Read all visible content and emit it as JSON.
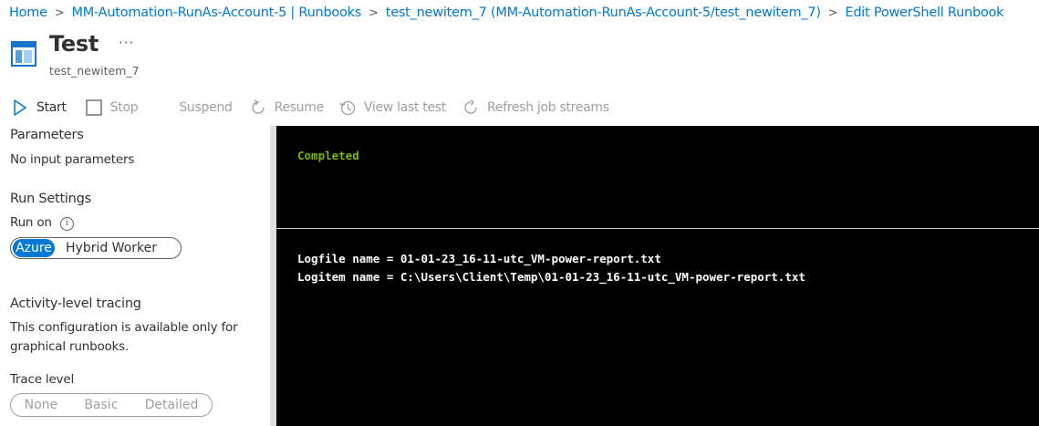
{
  "breadcrumb": [
    "Home",
    "MM-Automation-RunAs-Account-5 | Runbooks",
    "test_newitem_7 (MM-Automation-RunAs-Account-5/test_newitem_7)",
    "Edit PowerShell Runbook"
  ],
  "header": {
    "title": "Test",
    "subtitle": "test_newitem_7",
    "more": "···"
  },
  "toolbar": {
    "start": "Start",
    "stop": "Stop",
    "suspend": "Suspend",
    "resume": "Resume",
    "view_last_test": "View last test",
    "refresh": "Refresh job streams"
  },
  "left": {
    "parameters_heading": "Parameters",
    "parameters_text": "No input parameters",
    "run_settings_heading": "Run Settings",
    "run_on_label": "Run on",
    "run_on_options": [
      "Azure",
      "Hybrid Worker"
    ],
    "run_on_selected": "Azure",
    "tracing_heading": "Activity-level tracing",
    "tracing_text_1": "This configuration is available only for",
    "tracing_text_2": "graphical runbooks.",
    "trace_level_label": "Trace level",
    "trace_level_options": [
      "None",
      "Basic",
      "Detailed"
    ]
  },
  "console": {
    "status": "Completed",
    "status_color": "#7ab800",
    "output": [
      "Logfile name = 01-01-23_16-11-utc_VM-power-report.txt",
      "Logitem name = C:\\Users\\Client\\Temp\\01-01-23_16-11-utc_VM-power-report.txt"
    ]
  },
  "colors": {
    "accent": "#0078d4",
    "console_bg": "#000000"
  }
}
